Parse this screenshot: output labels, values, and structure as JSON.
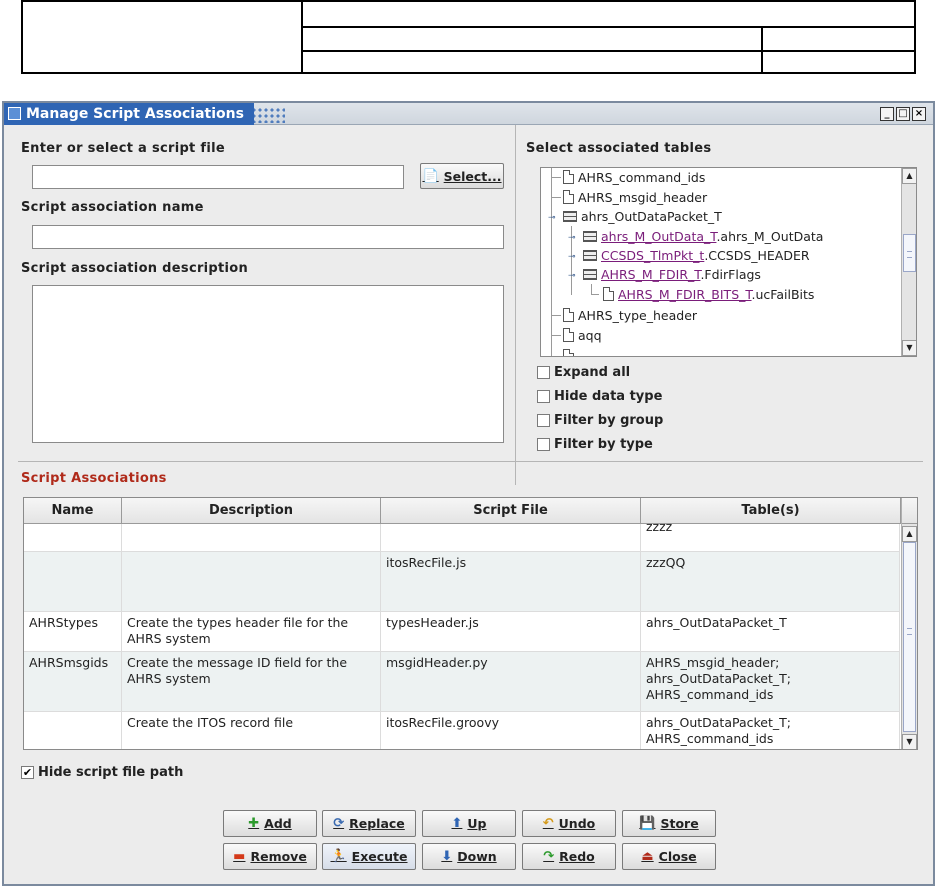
{
  "window": {
    "title": "Manage Script Associations",
    "controls": [
      "_",
      "□",
      "×"
    ]
  },
  "script_file": {
    "label": "Enter or select a script file",
    "value": "",
    "select_button": "Select..."
  },
  "assoc_name": {
    "label": "Script association name",
    "value": ""
  },
  "assoc_desc": {
    "label": "Script association description",
    "value": ""
  },
  "tables_panel": {
    "label": "Select associated tables",
    "tree": [
      {
        "text": "AHRS_command_ids",
        "icon": "file-icon"
      },
      {
        "text": "AHRS_msgid_header",
        "icon": "file-icon"
      },
      {
        "text": "ahrs_OutDataPacket_T",
        "icon": "table-icon"
      },
      {
        "type_part": "ahrs_M_OutData_T",
        "rest": ".ahrs_M_OutData",
        "icon": "table-icon"
      },
      {
        "type_part": "CCSDS_TlmPkt_t",
        "rest": ".CCSDS_HEADER",
        "icon": "table-icon"
      },
      {
        "type_part": "AHRS_M_FDIR_T",
        "rest": ".FdirFlags",
        "icon": "table-icon"
      },
      {
        "type_part": "AHRS_M_FDIR_BITS_T",
        "rest": ".ucFailBits",
        "icon": "file-icon"
      },
      {
        "text": "AHRS_type_header",
        "icon": "file-icon"
      },
      {
        "text": "aqq",
        "icon": "file-icon"
      }
    ],
    "options": [
      {
        "label": "Expand all",
        "checked": false
      },
      {
        "label": "Hide data type",
        "checked": false
      },
      {
        "label": "Filter by group",
        "checked": false
      },
      {
        "label": "Filter by type",
        "checked": false
      }
    ]
  },
  "associations": {
    "label": "Script Associations",
    "columns": [
      "Name",
      "Description",
      "Script File",
      "Table(s)"
    ],
    "rows": [
      {
        "name": "",
        "description": "",
        "script": "",
        "tables": "zzzz"
      },
      {
        "name": "",
        "description": "",
        "script": "itosRecFile.js",
        "tables": "zzzQQ"
      },
      {
        "name": "AHRStypes",
        "description": "Create the types header file for the AHRS system",
        "script": "typesHeader.js",
        "tables": "ahrs_OutDataPacket_T"
      },
      {
        "name": "AHRSmsgids",
        "description": "Create the message ID field for the AHRS system",
        "script": "msgidHeader.py",
        "tables": "AHRS_msgid_header;\nahrs_OutDataPacket_T;\nAHRS_command_ids"
      },
      {
        "name": "",
        "description": "Create the ITOS record file",
        "script": "itosRecFile.groovy",
        "tables": "ahrs_OutDataPacket_T;\nAHRS_command_ids"
      }
    ]
  },
  "hide_path": {
    "label": "Hide script file path",
    "checked": true,
    "mark": "✔"
  },
  "buttons": {
    "add": "Add",
    "replace": "Replace",
    "up": "Up",
    "undo": "Undo",
    "store": "Store",
    "remove": "Remove",
    "execute": "Execute",
    "down": "Down",
    "redo": "Redo",
    "close": "Close"
  },
  "colors": {
    "title_tab": "#2f65b4",
    "section_label": "#b02a1a",
    "type_link": "#7a1d7a"
  }
}
